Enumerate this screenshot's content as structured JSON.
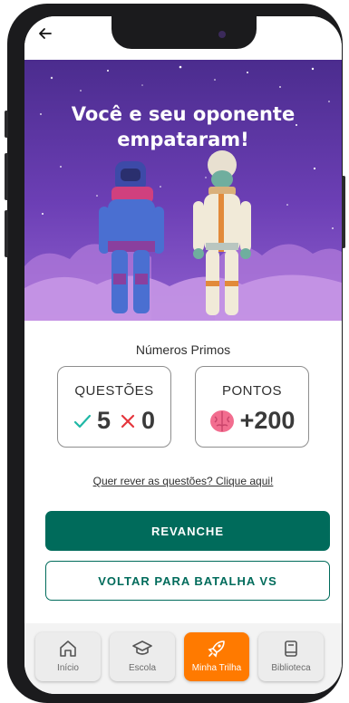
{
  "result": {
    "title": "Você e seu oponente empataram!"
  },
  "quiz": {
    "subject": "Números Primos"
  },
  "questions_card": {
    "title": "QUESTÕES",
    "correct": "5",
    "wrong": "0"
  },
  "points_card": {
    "title": "PONTOS",
    "value": "+200"
  },
  "review_link": "Quer rever as questões? Clique aqui!",
  "actions": {
    "rematch": "REVANCHE",
    "back_to_battle": "VOLTAR PARA BATALHA VS"
  },
  "bottom_nav": {
    "items": [
      {
        "label": "Início",
        "icon": "home-icon",
        "active": false
      },
      {
        "label": "Escola",
        "icon": "graduation-cap-icon",
        "active": false
      },
      {
        "label": "Minha Trilha",
        "icon": "rocket-icon",
        "active": true
      },
      {
        "label": "Biblioteca",
        "icon": "book-icon",
        "active": false
      }
    ]
  },
  "colors": {
    "primary": "#006b5b",
    "accent": "#ff7a00",
    "hero_top": "#4b2c8e",
    "hero_bottom": "#8f5fcf",
    "correct": "#1fb8a6",
    "wrong": "#e5363d",
    "brain": "#f26d8f"
  }
}
